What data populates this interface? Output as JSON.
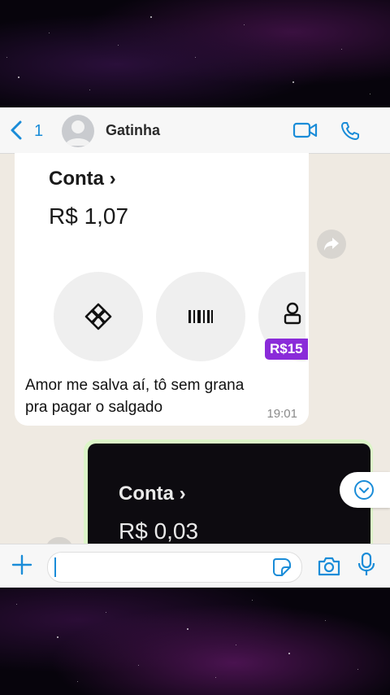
{
  "header": {
    "back_count": "1",
    "contact_name": "Gatinha"
  },
  "incoming_message": {
    "card_title": "Conta ›",
    "card_value": "R$ 1,07",
    "promo_badge": "R$15",
    "text_line1": "Amor me salva aí, tô sem grana",
    "text_line2": "pra pagar o salgado",
    "time": "19:01"
  },
  "outgoing_message": {
    "card_title": "Conta ›",
    "card_value": "R$ 0,03"
  },
  "colors": {
    "accent": "#1a8cd8",
    "promo": "#8a2bd9",
    "chat_bg": "#efeae2",
    "outgoing_bubble": "#dcf5c8"
  },
  "icons": [
    "back-chevron-icon",
    "avatar-placeholder-icon",
    "video-call-icon",
    "phone-icon",
    "pix-icon",
    "barcode-icon",
    "forward-icon",
    "scroll-down-icon",
    "plus-icon",
    "sticker-icon",
    "camera-icon",
    "microphone-icon"
  ]
}
